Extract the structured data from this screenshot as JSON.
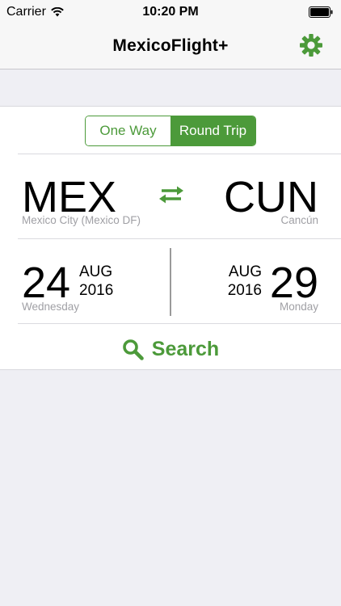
{
  "status_bar": {
    "carrier": "Carrier",
    "time": "10:20 PM"
  },
  "nav": {
    "title": "MexicoFlight+",
    "settings_icon": "gear-icon"
  },
  "trip_type": {
    "options": [
      "One Way",
      "Round Trip"
    ],
    "selected": "Round Trip"
  },
  "origin": {
    "code": "MEX",
    "city": "Mexico City (Mexico DF)"
  },
  "destination": {
    "code": "CUN",
    "city": "Cancún"
  },
  "departure": {
    "day": "24",
    "month": "AUG",
    "year": "2016",
    "weekday": "Wednesday"
  },
  "return": {
    "day": "29",
    "month": "AUG",
    "year": "2016",
    "weekday": "Monday"
  },
  "search": {
    "label": "Search",
    "icon": "search-icon"
  },
  "colors": {
    "accent": "#4c9a3a",
    "background": "#efeff4",
    "muted_text": "#a0a0a5"
  }
}
